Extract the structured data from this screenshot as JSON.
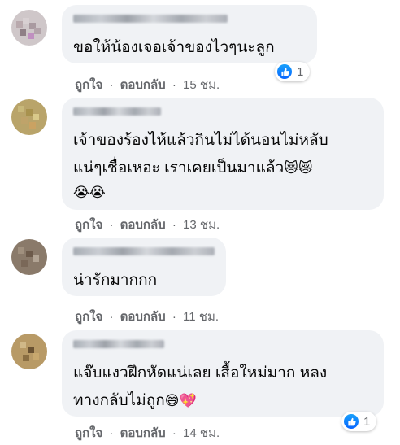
{
  "actions": {
    "like": "ถูกใจ",
    "reply": "ตอบกลับ",
    "dot": "·"
  },
  "comments": [
    {
      "lines": [
        "ขอให้น้องเจอเจ้าของไวๆนะลูก"
      ],
      "time": "15 ชม.",
      "reaction_count": "1"
    },
    {
      "lines": [
        "เจ้าของร้องไห้แล้วกินไม่ได้นอนไม่หลับ",
        "แน่ๆเชื่อเหอะ เราเคยเป็นมาแล้ว"
      ],
      "emoji_line1": "😿😿",
      "emoji_line2": "😭😭",
      "time": "13 ชม."
    },
    {
      "lines": [
        "น่ารักมากกก"
      ],
      "time": "11 ชม."
    },
    {
      "lines": [
        "แจ๊บแงวฝึกหัดแน่เลย เสื้อใหม่มาก หลง",
        "ทางกลับไม่ถูก"
      ],
      "emoji_line2": "😅💖",
      "time": "14 ชม.",
      "reaction_count": "1"
    }
  ],
  "colors": {
    "like_blue": "#0866ff",
    "bubble": "#f0f2f5",
    "meta": "#65676b"
  },
  "icons": {
    "reaction": "like-thumb-icon"
  }
}
